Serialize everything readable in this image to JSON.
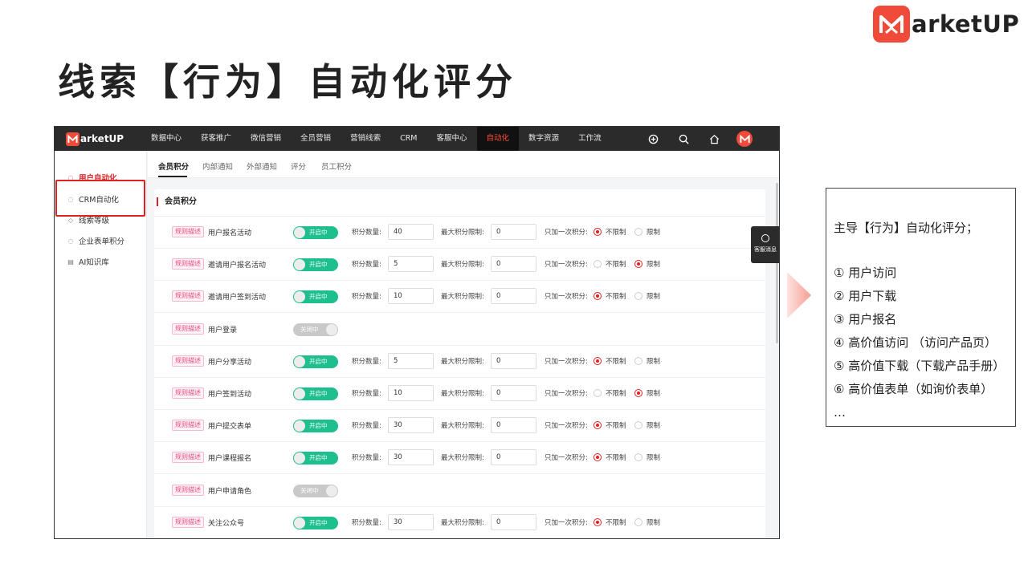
{
  "brand": {
    "name": "arketUP"
  },
  "slide_title": "线索【行为】自动化评分",
  "app": {
    "logo_text": "arketUP",
    "nav": [
      "数据中心",
      "获客推广",
      "微信营销",
      "全员营销",
      "营销线索",
      "CRM",
      "客服中心",
      "自动化",
      "数字资源",
      "工作流"
    ],
    "active_nav": "自动化",
    "sidebar": [
      "用户自动化",
      "CRM自动化",
      "线索等级",
      "企业表单积分",
      "AI知识库"
    ],
    "tabs": [
      "会员积分",
      "内部通知",
      "外部通知",
      "评分",
      "员工积分"
    ],
    "panel_title": "会员积分",
    "labels": {
      "tag": "规则描述",
      "points": "积分数量:",
      "max": "最大积分限制:",
      "once": "只加一次积分:",
      "unlimited": "不限制",
      "limited": "限制",
      "on": "开启中",
      "off": "关闭中"
    },
    "rows": [
      {
        "name": "用户报名活动",
        "enabled": true,
        "points": "40",
        "max": "0",
        "limit": "不限制"
      },
      {
        "name": "邀请用户报名活动",
        "enabled": true,
        "points": "5",
        "max": "0",
        "limit": "限制"
      },
      {
        "name": "邀请用户签到活动",
        "enabled": true,
        "points": "10",
        "max": "0",
        "limit": "不限制"
      },
      {
        "name": "用户登录",
        "enabled": false
      },
      {
        "name": "用户分享活动",
        "enabled": true,
        "points": "5",
        "max": "0",
        "limit": "不限制"
      },
      {
        "name": "用户签到活动",
        "enabled": true,
        "points": "10",
        "max": "0",
        "limit": "限制"
      },
      {
        "name": "用户提交表单",
        "enabled": true,
        "points": "30",
        "max": "0",
        "limit": "不限制"
      },
      {
        "name": "用户课程报名",
        "enabled": true,
        "points": "30",
        "max": "0",
        "limit": "不限制"
      },
      {
        "name": "用户申请角色",
        "enabled": false
      },
      {
        "name": "关注公众号",
        "enabled": true,
        "points": "30",
        "max": "0",
        "limit": "不限制"
      }
    ],
    "chat_label": "客服消息"
  },
  "notes": {
    "heading": "主导【行为】自动化评分；",
    "items": [
      "① 用户访问",
      "② 用户下载",
      "③ 用户报名",
      "④ 高价值访问 （访问产品页）",
      "⑤ 高价值下载（下载产品手册）",
      "⑥ 高价值表单（如询价表单）",
      "…"
    ]
  },
  "colors": {
    "accent": "#e0201f",
    "toggle_on": "#1dbf8e",
    "toggle_off": "#c9c9c9",
    "topbar": "#2b2b2b"
  }
}
